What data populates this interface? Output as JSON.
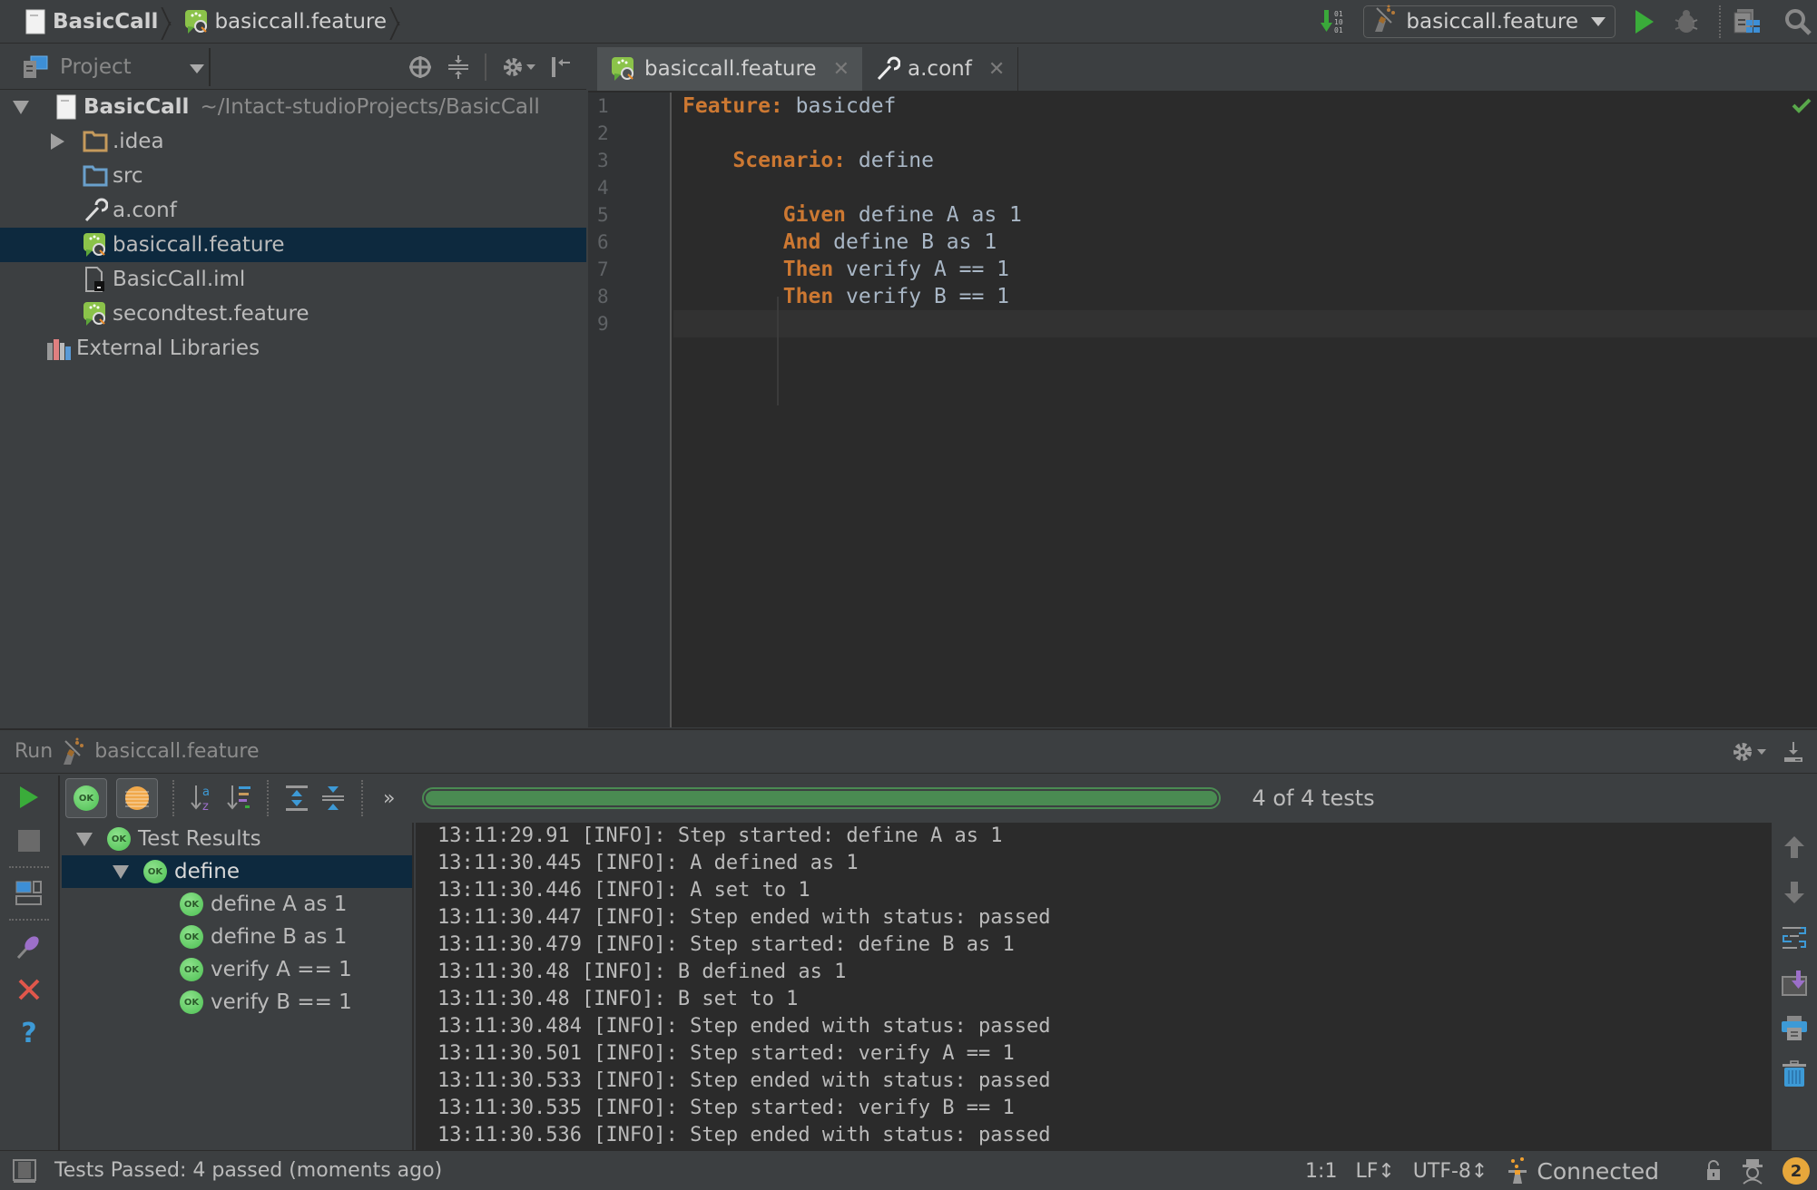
{
  "navbar": {
    "breadcrumbs": [
      "BasicCall",
      "basiccall.feature"
    ],
    "run_config": "basiccall.feature"
  },
  "project": {
    "title": "Project",
    "tree": [
      {
        "label": "BasicCall",
        "path": "~/Intact-studioProjects/BasicCall",
        "icon": "module-icon",
        "expanded": true
      },
      {
        "label": ".idea",
        "icon": "folder-icon",
        "expanded": false
      },
      {
        "label": "src",
        "icon": "source-folder-icon"
      },
      {
        "label": "a.conf",
        "icon": "wrench-icon"
      },
      {
        "label": "basiccall.feature",
        "icon": "cucumber-icon",
        "selected": true
      },
      {
        "label": "BasicCall.iml",
        "icon": "iml-file-icon"
      },
      {
        "label": "secondtest.feature",
        "icon": "cucumber-icon"
      },
      {
        "label": "External Libraries",
        "icon": "libraries-icon"
      }
    ]
  },
  "editor": {
    "tabs": [
      {
        "label": "basiccall.feature",
        "active": true
      },
      {
        "label": "a.conf",
        "active": false
      }
    ],
    "line_numbers": [
      "1",
      "2",
      "3",
      "4",
      "5",
      "6",
      "7",
      "8",
      "9"
    ],
    "lines": [
      {
        "kw": "Feature:",
        "text": " basicdef",
        "indent": ""
      },
      {
        "kw": "",
        "text": "",
        "indent": ""
      },
      {
        "kw": "Scenario:",
        "text": " define",
        "indent": "    "
      },
      {
        "kw": "",
        "text": "",
        "indent": ""
      },
      {
        "kw": "Given",
        "text": " define A as 1",
        "indent": "        "
      },
      {
        "kw": "And",
        "text": " define B as 1",
        "indent": "        "
      },
      {
        "kw": "Then",
        "text": " verify A == 1",
        "indent": "        "
      },
      {
        "kw": "Then",
        "text": " verify B == 1",
        "indent": "        "
      },
      {
        "kw": "",
        "text": "",
        "indent": ""
      }
    ]
  },
  "run": {
    "label": "Run",
    "config": "basiccall.feature",
    "progress_percent": 100,
    "progress_label": "4 of 4 tests",
    "test_tree": [
      {
        "label": "Test Results",
        "level": 0,
        "expanded": true
      },
      {
        "label": "define",
        "level": 1,
        "expanded": true,
        "selected": true
      },
      {
        "label": "define A as 1",
        "level": 2
      },
      {
        "label": "define B as 1",
        "level": 2
      },
      {
        "label": "verify A == 1",
        "level": 2
      },
      {
        "label": "verify B == 1",
        "level": 2
      }
    ],
    "ok_label": "OK",
    "console": [
      "13:11:29.91 [INFO]: Step started: define A as 1",
      "13:11:30.445 [INFO]: A defined as 1",
      "13:11:30.446 [INFO]: A set to 1",
      "13:11:30.447 [INFO]: Step ended with status: passed",
      "13:11:30.479 [INFO]: Step started: define B as 1",
      "13:11:30.48 [INFO]: B defined as 1",
      "13:11:30.48 [INFO]: B set to 1",
      "13:11:30.484 [INFO]: Step ended with status: passed",
      "13:11:30.501 [INFO]: Step started: verify A == 1",
      "13:11:30.533 [INFO]: Step ended with status: passed",
      "13:11:30.535 [INFO]: Step started: verify B == 1",
      "13:11:30.536 [INFO]: Step ended with status: passed"
    ]
  },
  "statusbar": {
    "message": "Tests Passed: 4 passed (moments ago)",
    "position": "1:1",
    "line_separator": "LF↕",
    "encoding": "UTF-8↕",
    "connection": "Connected",
    "notifications": "2"
  },
  "colors": {
    "accent_green": "#4a8b52",
    "keyword_orange": "#cc7832",
    "selection": "#0d293e"
  }
}
